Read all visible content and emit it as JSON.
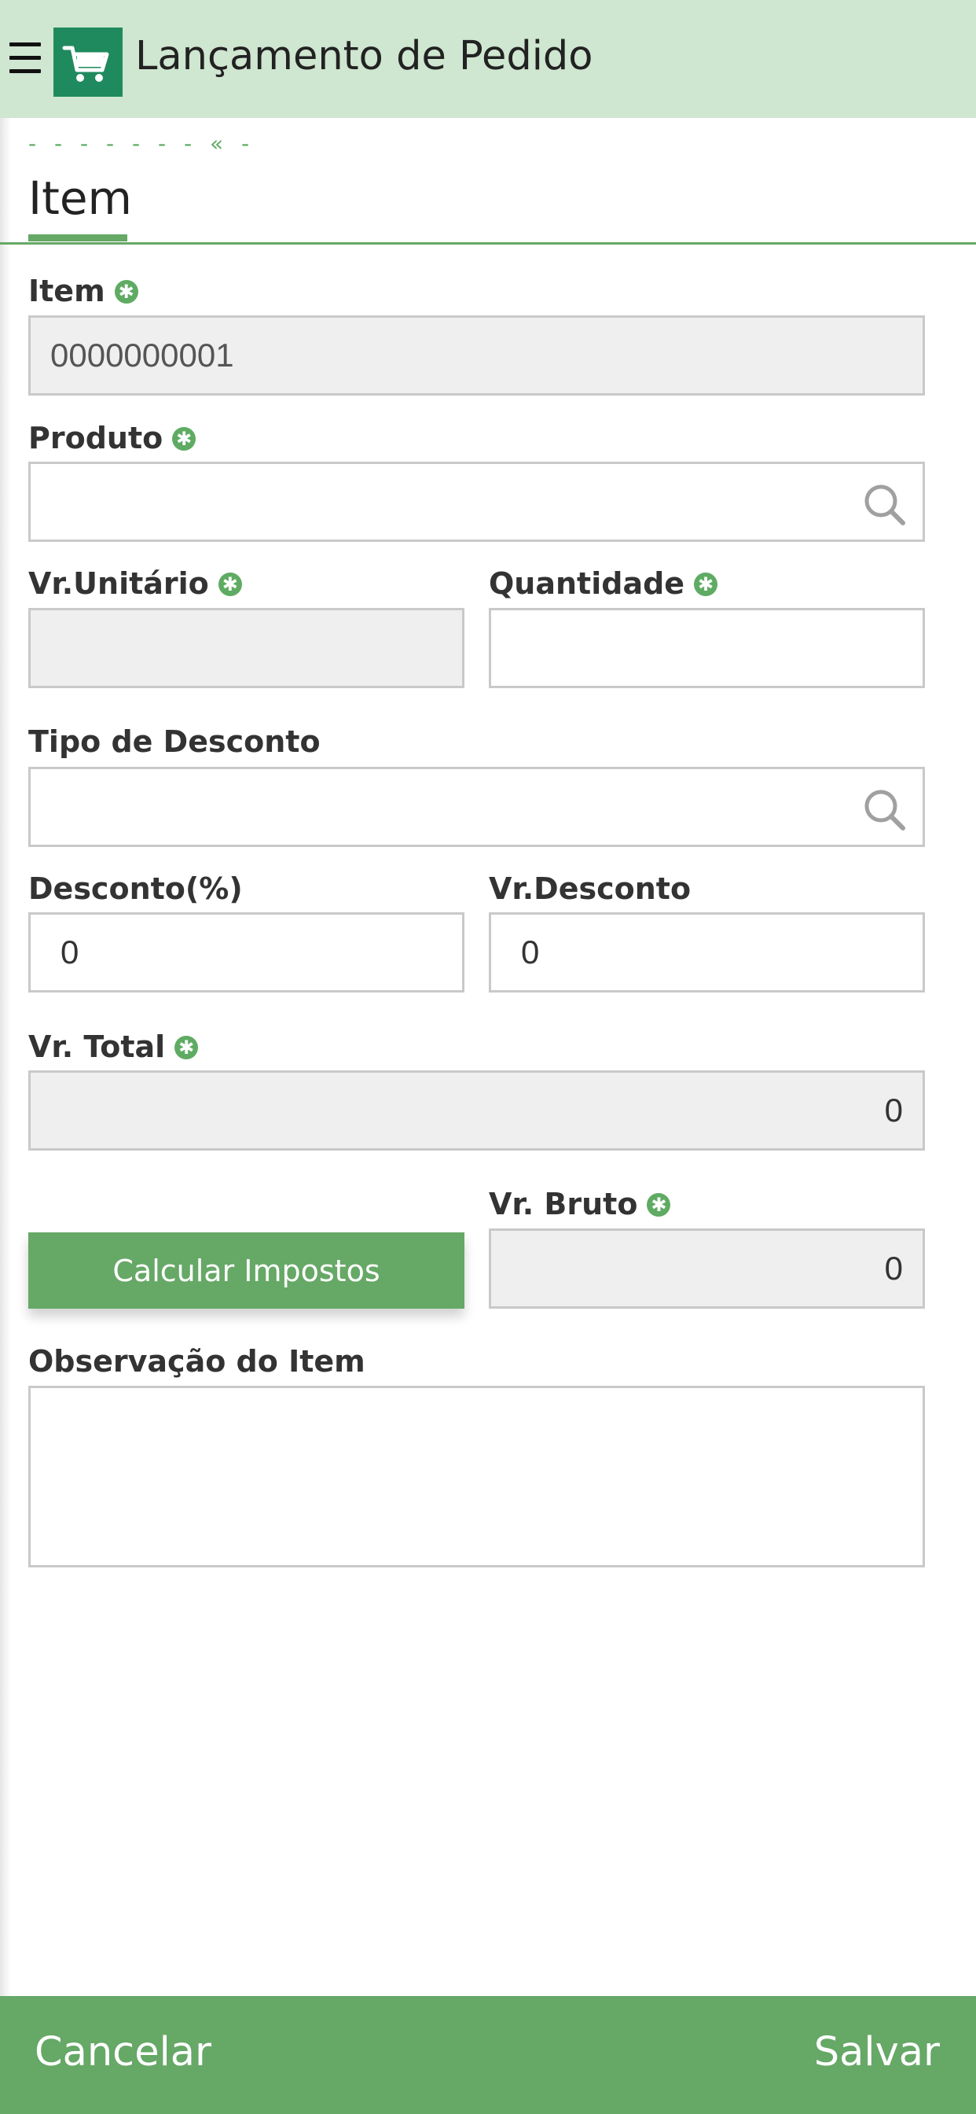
{
  "header": {
    "title": "Lançamento de Pedido",
    "menu_icon": "hamburger-menu-icon",
    "logo_icon": "shopping-cart-icon"
  },
  "breadcrumb": "- - - - - - -  «  -",
  "tab": {
    "label": "Item"
  },
  "form": {
    "item": {
      "label": "Item",
      "value": "0000000001",
      "required": true
    },
    "produto": {
      "label": "Produto",
      "value": "",
      "required": true,
      "icon": "search-icon"
    },
    "vr_unitario": {
      "label": "Vr.Unitário",
      "value": "",
      "required": true
    },
    "quantidade": {
      "label": "Quantidade",
      "value": "",
      "required": true
    },
    "tipo_desconto": {
      "label": "Tipo de Desconto",
      "value": "",
      "icon": "search-icon"
    },
    "desconto_pct": {
      "label": "Desconto(%)",
      "value": "0"
    },
    "vr_desconto": {
      "label": "Vr.Desconto",
      "value": "0"
    },
    "vr_total": {
      "label": "Vr. Total",
      "value": "0",
      "required": true
    },
    "vr_bruto": {
      "label": "Vr. Bruto",
      "value": "0",
      "required": true
    },
    "calc_button": "Calcular Impostos",
    "observacao": {
      "label": "Observação do Item",
      "value": ""
    }
  },
  "footer": {
    "cancel": "Cancelar",
    "save": "Salvar"
  },
  "colors": {
    "header_bg": "#cfe6d0",
    "accent": "#66a866",
    "required_icon": "#5fab63",
    "readonly_bg": "#efefef",
    "logo_bg": "#1f8a5e"
  }
}
